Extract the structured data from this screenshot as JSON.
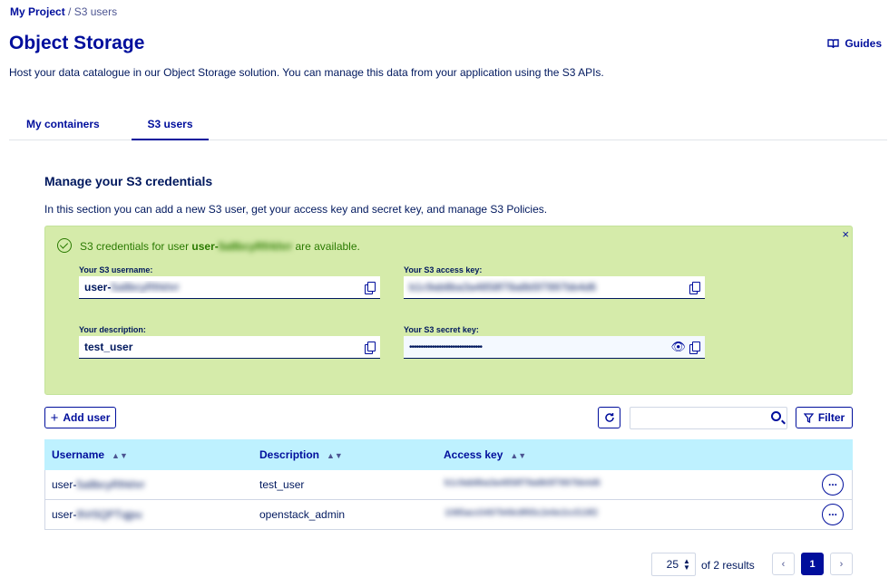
{
  "breadcrumb": {
    "project": "My Project",
    "separator": "/",
    "current": "S3 users"
  },
  "header": {
    "title": "Object Storage",
    "guides_label": "Guides",
    "subtitle": "Host your data catalogue in our Object Storage solution. You can manage this data from your application using the S3 APIs."
  },
  "tabs": [
    {
      "label": "My containers"
    },
    {
      "label": "S3 users"
    }
  ],
  "section": {
    "title": "Manage your S3 credentials",
    "description": "In this section you can add a new S3 user, get your access key and secret key, and manage S3 Policies."
  },
  "banner": {
    "msg_prefix": "S3 credentials for user ",
    "msg_user": "user-",
    "msg_user_blurred": "5a8bcyRfrkhrr",
    "msg_suffix": " are available.",
    "username_label": "Your S3 username:",
    "username_prefix": "user-",
    "username_blurred": "5a8bcyRfrkhrr",
    "access_key_label": "Your S3 access key:",
    "access_key_blurred": "b1c9ab8ba3a4858f78a8b5f7897bb4d6",
    "description_label": "Your description:",
    "description_value": "test_user",
    "secret_key_label": "Your S3 secret key:",
    "secret_key_masked": "••••••••••••••••••••••••••••••••",
    "close": "×"
  },
  "toolbar": {
    "add_user": "Add user",
    "filter": "Filter",
    "search_placeholder": ""
  },
  "table": {
    "headers": {
      "username": "Username",
      "description": "Description",
      "access_key": "Access key"
    },
    "rows": [
      {
        "username_prefix": "user-",
        "username_blurred": "5a8bcyRfrkhrr",
        "description": "test_user",
        "access_key_blurred": "b1c9ab8ba3a4858f78a8b5f7897bb4d6"
      },
      {
        "username_prefix": "user-",
        "username_blurred": "9Vr5QPTqjpu",
        "description": "openstack_admin",
        "access_key_blurred": "1085acc0497949c8f65c2e6e2cc519f2"
      }
    ]
  },
  "pagination": {
    "page_size": "25",
    "results_text": "of 2 results",
    "current_page": "1",
    "prev": "‹",
    "next": "›"
  }
}
